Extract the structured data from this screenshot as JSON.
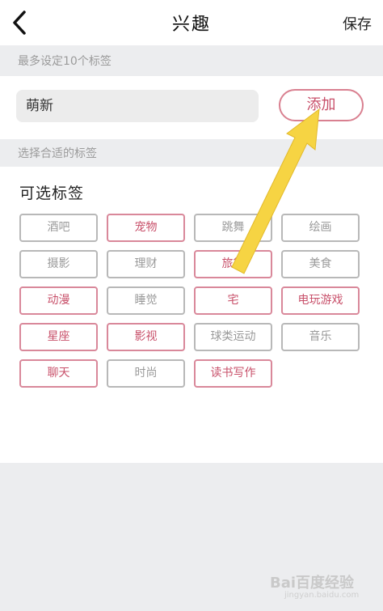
{
  "nav": {
    "title": "兴趣",
    "save_label": "保存"
  },
  "hint_max": "最多设定10个标签",
  "input": {
    "value": "萌新"
  },
  "add_label": "添加",
  "hint_choose": "选择合适的标签",
  "panel_title": "可选标签",
  "tags": [
    {
      "label": "酒吧",
      "selected": false
    },
    {
      "label": "宠物",
      "selected": true
    },
    {
      "label": "跳舞",
      "selected": false
    },
    {
      "label": "绘画",
      "selected": false
    },
    {
      "label": "摄影",
      "selected": false
    },
    {
      "label": "理财",
      "selected": false
    },
    {
      "label": "旅行",
      "selected": true
    },
    {
      "label": "美食",
      "selected": false
    },
    {
      "label": "动漫",
      "selected": true
    },
    {
      "label": "睡觉",
      "selected": false
    },
    {
      "label": "宅",
      "selected": true
    },
    {
      "label": "电玩游戏",
      "selected": true
    },
    {
      "label": "星座",
      "selected": true
    },
    {
      "label": "影视",
      "selected": true
    },
    {
      "label": "球类运动",
      "selected": false
    },
    {
      "label": "音乐",
      "selected": false
    },
    {
      "label": "聊天",
      "selected": true
    },
    {
      "label": "时尚",
      "selected": false
    },
    {
      "label": "读书写作",
      "selected": true
    }
  ],
  "colors": {
    "accent": "#c8506a",
    "arrow": "#f5d23c"
  },
  "watermark": {
    "text": "Bai百度经验",
    "sub": "jingyan.baidu.com"
  }
}
